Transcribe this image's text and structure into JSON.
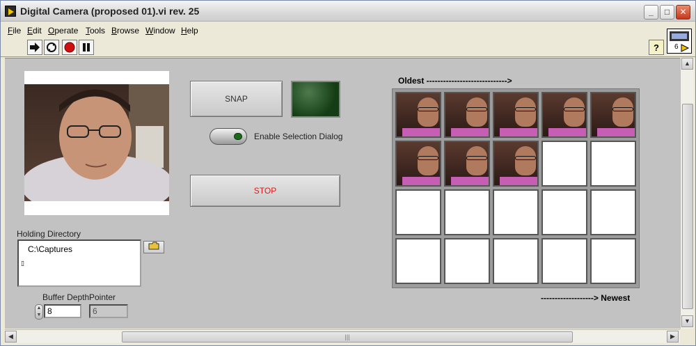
{
  "window": {
    "title": "Digital Camera (proposed 01).vi rev. 25"
  },
  "menu": [
    {
      "label": "File",
      "accel": "F",
      "rest": "ile"
    },
    {
      "label": "Edit",
      "accel": "E",
      "rest": "dit"
    },
    {
      "label": "Operate",
      "accel": "O",
      "rest": "perate"
    },
    {
      "label": "Tools",
      "accel": "T",
      "rest": "ools"
    },
    {
      "label": "Browse",
      "accel": "B",
      "rest": "rowse"
    },
    {
      "label": "Window",
      "accel": "W",
      "rest": "indow"
    },
    {
      "label": "Help",
      "accel": "H",
      "rest": "elp"
    }
  ],
  "toolbar": {
    "run_icon": "run-arrow-icon",
    "run_continuous_icon": "run-continuously-icon",
    "abort_icon": "abort-icon",
    "pause_icon": "pause-icon",
    "help_label": "?",
    "vi_icon_number": "6"
  },
  "controls": {
    "snap_label": "SNAP",
    "stop_label": "STOP",
    "enable_selection_label": "Enable Selection Dialog",
    "holding_directory_label": "Holding Directory",
    "holding_directory_value": "C:\\Captures",
    "buffer_depth_label": "Buffer Depth",
    "buffer_depth_value": "8",
    "pointer_label": "Pointer",
    "pointer_value": "6"
  },
  "gallery": {
    "oldest_label": "Oldest ----------------------------->",
    "newest_label": "-------------------> Newest",
    "rows": 4,
    "cols": 5,
    "filled_count": 8
  },
  "colors": {
    "stop_text": "#e01818",
    "led": "#1a4d1a",
    "panel": "#c2c2c2"
  }
}
